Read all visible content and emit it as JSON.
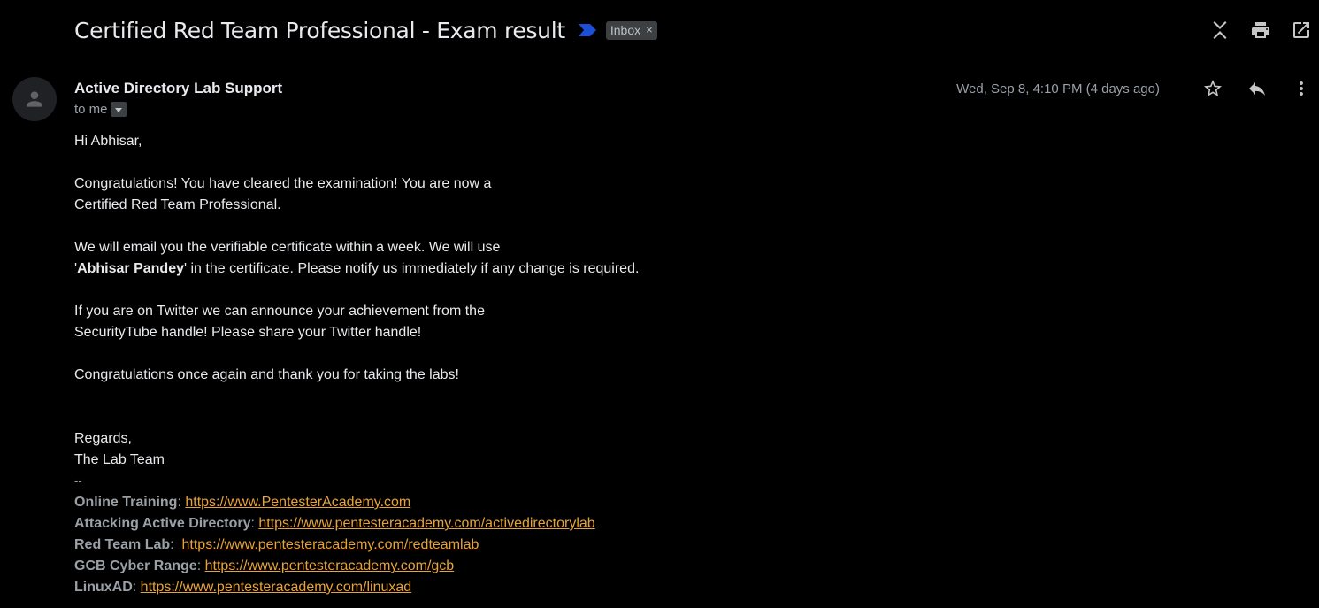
{
  "header": {
    "subject": "Certified Red Team Professional - Exam result",
    "label": "Inbox",
    "label_close": "×",
    "icons": [
      "collapse-all-icon",
      "print-icon",
      "open-in-new-window-icon"
    ]
  },
  "message": {
    "sender_name": "Active Directory Lab Support",
    "recipient": "to me",
    "date": "Wed, Sep 8, 4:10 PM (4 days ago)",
    "icons": [
      "star-icon",
      "reply-icon",
      "more-vert-icon"
    ],
    "body": {
      "greeting": "Hi Abhisar,",
      "p1_line1": "Congratulations! You have cleared the examination! You are now a",
      "p1_line2": "Certified Red Team Professional.",
      "p2_line1": "We will email you the verifiable certificate within a week. We will use",
      "p2_quote_open": "'",
      "p2_name": "Abhisar Pandey",
      "p2_rest": "' in the certificate. Please notify us immediately if any change is required.",
      "p3_line1": "If you are on Twitter we can announce your achievement from the",
      "p3_line2": "SecurityTube handle! Please share your Twitter handle!",
      "p4": "Congratulations once again and thank you for taking the labs!",
      "regards": "Regards,",
      "team": "The Lab Team",
      "sig_dash": "--"
    },
    "signature": [
      {
        "label": "Online Training",
        "sep": ": ",
        "url": "https://www.PentesterAcademy.com"
      },
      {
        "label": "Attacking Active Directory",
        "sep": ": ",
        "url": "https://www.pentesteracademy.com/activedirectorylab"
      },
      {
        "label": "Red Team Lab",
        "sep": ":  ",
        "url": "https://www.pentesteracademy.com/redteamlab"
      },
      {
        "label": "GCB Cyber Range",
        "sep": ": ",
        "url": "https://www.pentesteracademy.com/gcb"
      },
      {
        "label": "LinuxAD",
        "sep": ": ",
        "url": "https://www.pentesteracademy.com/linuxad"
      }
    ]
  },
  "colors": {
    "background": "#000000",
    "link": "#e8a338",
    "importance_marker": "#1a4fd6",
    "text": "#e8eaed",
    "muted": "#9aa0a6"
  }
}
